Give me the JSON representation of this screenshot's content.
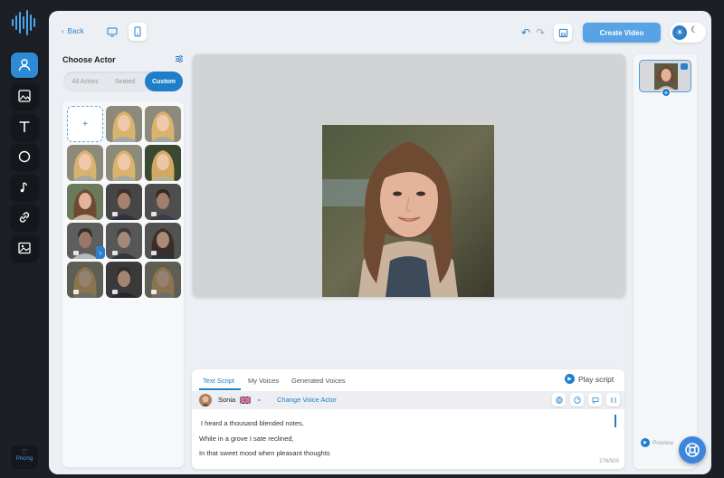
{
  "app": {
    "logo_icon": "soundwave-logo-icon",
    "accent": "#2e7fc7"
  },
  "sidebar": {
    "items": [
      {
        "name": "actor",
        "icon": "person-icon",
        "active": true
      },
      {
        "name": "image",
        "icon": "image-icon"
      },
      {
        "name": "text",
        "icon": "text-icon"
      },
      {
        "name": "shape",
        "icon": "circle-icon"
      },
      {
        "name": "music",
        "icon": "music-note-icon"
      },
      {
        "name": "link",
        "icon": "link-icon"
      },
      {
        "name": "media",
        "icon": "picture-icon"
      }
    ],
    "pricing_label": "Pricing"
  },
  "header": {
    "back_label": "Back",
    "create_label": "Create Video"
  },
  "actor_panel": {
    "title": "Choose Actor",
    "tabs": [
      "All Actors",
      "Seated",
      "Custom"
    ],
    "active_tab": "Custom",
    "add_label": "+"
  },
  "script": {
    "tabs": [
      "Text Script",
      "My Voices",
      "Generated Voices"
    ],
    "active_tab": "Text Script",
    "play_label": "Play script",
    "voice_name": "Sonia",
    "change_label": "Change Voice Actor",
    "lines": [
      "I heard a thousand blended notes,",
      "While in a grove I sate reclined,",
      "In that sweet mood when pleasant thoughts"
    ],
    "counter": "276/500"
  },
  "right_panel": {
    "preview_label": "Preview"
  }
}
